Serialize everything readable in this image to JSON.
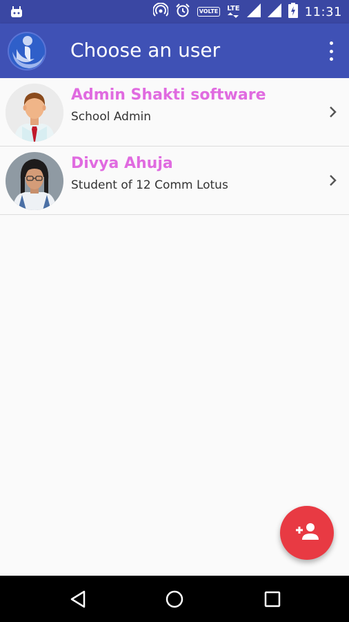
{
  "status_bar": {
    "time": "11:31",
    "volte_label": "VOLTE",
    "lte_label": "LTE",
    "icons": [
      "android-notification-icon",
      "hotspot-icon",
      "alarm-icon",
      "volte-icon",
      "lte-icon",
      "signal-icon",
      "signal-icon",
      "battery-charging-icon"
    ]
  },
  "app_bar": {
    "title": "Choose an user",
    "logo_icon": "app-logo-icon",
    "menu_icon": "overflow-menu-icon"
  },
  "users": [
    {
      "name": "Admin Shakti software",
      "role": "School Admin",
      "avatar": "admin-avatar"
    },
    {
      "name": "Divya Ahuja",
      "role": "Student of 12 Comm Lotus",
      "avatar": "student-avatar"
    }
  ],
  "fab": {
    "icon": "add-user-icon"
  },
  "nav_bar": {
    "icons": [
      "back-icon",
      "home-icon",
      "recents-icon"
    ]
  },
  "colors": {
    "primary": "#3f51b5",
    "primary_dark": "#3a47a3",
    "name_text": "#e06be0",
    "fab": "#e83a43"
  }
}
